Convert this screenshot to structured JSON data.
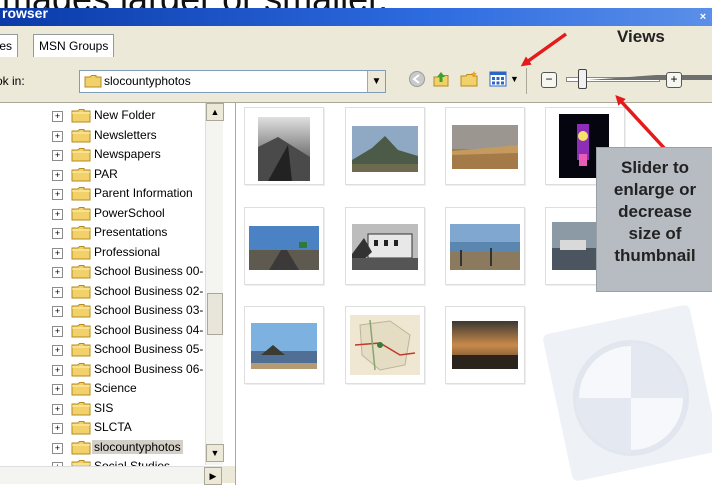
{
  "caption": "images larger or smaller.",
  "window": {
    "title": "rowser"
  },
  "tabs": [
    {
      "label": "iles"
    },
    {
      "label": "MSN Groups"
    }
  ],
  "annotation": {
    "views_label": "Views",
    "slider_callout": [
      "Slider to",
      "enlarge or",
      "decrease",
      "size of",
      "thumbnail"
    ]
  },
  "toolbar": {
    "look_in_label": "ok in:",
    "look_in_value": "slocountyphotos",
    "icons": [
      "back-icon",
      "up-folder-icon",
      "new-folder-icon",
      "views-icon"
    ],
    "zoom_minus": "−",
    "zoom_plus": "+",
    "zoom_level": 0.1
  },
  "tree": {
    "items": [
      {
        "label": "New Folder"
      },
      {
        "label": "Newsletters"
      },
      {
        "label": "Newspapers"
      },
      {
        "label": "PAR"
      },
      {
        "label": "Parent Information"
      },
      {
        "label": "PowerSchool"
      },
      {
        "label": "Presentations"
      },
      {
        "label": "Professional"
      },
      {
        "label": "School Business 00-"
      },
      {
        "label": "School Business 02-"
      },
      {
        "label": "School Business 03-"
      },
      {
        "label": "School Business 04-"
      },
      {
        "label": "School Business 05-"
      },
      {
        "label": "School Business 06-"
      },
      {
        "label": "Science"
      },
      {
        "label": "SIS"
      },
      {
        "label": "SLCTA"
      },
      {
        "label": "slocountyphotos",
        "selected": true
      },
      {
        "label": "Social Studies"
      }
    ]
  },
  "colors": {
    "titlebar": "#0a3aa8",
    "folder": "#f2d16b",
    "arrow": "#e51b1b",
    "callout": "#b7bcc3"
  }
}
